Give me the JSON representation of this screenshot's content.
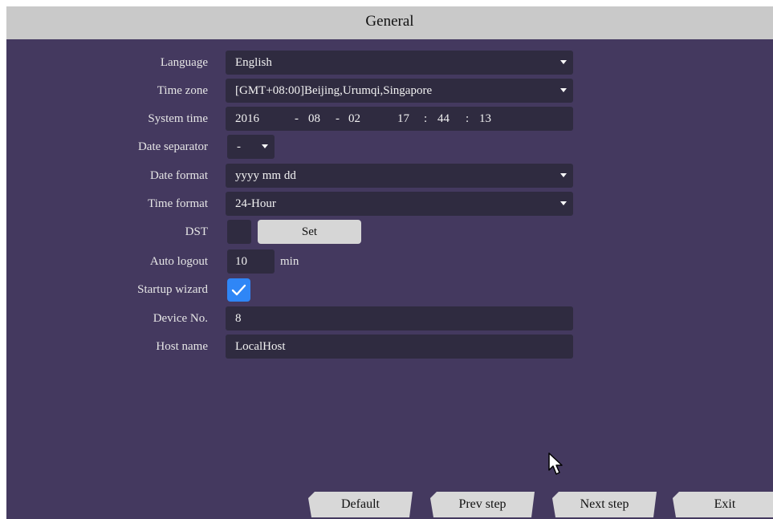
{
  "window": {
    "title": "General"
  },
  "form": {
    "language": {
      "label": "Language",
      "value": "English"
    },
    "time_zone": {
      "label": "Time zone",
      "value": "[GMT+08:00]Beijing,Urumqi,Singapore"
    },
    "system_time": {
      "label": "System time",
      "year": "2016",
      "sep1": "-",
      "month": "08",
      "sep2": "-",
      "day": "02",
      "hour": "17",
      "colon1": ":",
      "minute": "44",
      "colon2": ":",
      "second": "13"
    },
    "date_separator": {
      "label": "Date separator",
      "value": "-"
    },
    "date_format": {
      "label": "Date format",
      "value": "yyyy mm dd"
    },
    "time_format": {
      "label": "Time format",
      "value": "24-Hour"
    },
    "dst": {
      "label": "DST",
      "set_label": "Set",
      "checked": false
    },
    "auto_logout": {
      "label": "Auto logout",
      "value": "10",
      "unit": "min"
    },
    "startup_wizard": {
      "label": "Startup wizard",
      "checked": true
    },
    "device_no": {
      "label": "Device No.",
      "value": "8"
    },
    "host_name": {
      "label": "Host name",
      "value": "LocalHost"
    }
  },
  "buttons": {
    "default": "Default",
    "prev": "Prev step",
    "next": "Next step",
    "exit": "Exit"
  },
  "icons": {
    "dropdown": "chevron-down-icon",
    "check": "check-icon",
    "cursor": "mouse-pointer-icon"
  },
  "colors": {
    "background": "#44395f",
    "field": "#2f2b40",
    "titlebar": "#c9c9c9",
    "accent_checkbox": "#2f86f6",
    "button": "#d8d8d8"
  }
}
